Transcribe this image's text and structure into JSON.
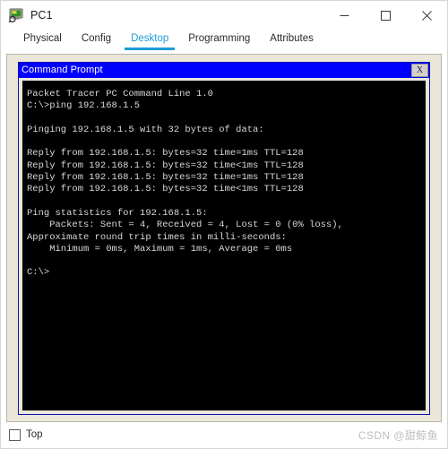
{
  "window": {
    "title": "PC1",
    "icon": "pc-device-icon",
    "controls": [
      {
        "name": "minimize-button",
        "glyph": "minimize-icon"
      },
      {
        "name": "maximize-button",
        "glyph": "maximize-icon"
      },
      {
        "name": "close-button",
        "glyph": "close-icon"
      }
    ]
  },
  "tabs": [
    {
      "label": "Physical",
      "active": false
    },
    {
      "label": "Config",
      "active": false
    },
    {
      "label": "Desktop",
      "active": true
    },
    {
      "label": "Programming",
      "active": false
    },
    {
      "label": "Attributes",
      "active": false
    }
  ],
  "console": {
    "title": "Command Prompt",
    "close_label": "X",
    "lines": [
      "Packet Tracer PC Command Line 1.0",
      "C:\\>ping 192.168.1.5",
      "",
      "Pinging 192.168.1.5 with 32 bytes of data:",
      "",
      "Reply from 192.168.1.5: bytes=32 time=1ms TTL=128",
      "Reply from 192.168.1.5: bytes=32 time<1ms TTL=128",
      "Reply from 192.168.1.5: bytes=32 time=1ms TTL=128",
      "Reply from 192.168.1.5: bytes=32 time<1ms TTL=128",
      "",
      "Ping statistics for 192.168.1.5:",
      "    Packets: Sent = 4, Received = 4, Lost = 0 (0% loss),",
      "Approximate round trip times in milli-seconds:",
      "    Minimum = 0ms, Maximum = 1ms, Average = 0ms",
      "",
      "C:\\>"
    ]
  },
  "footer": {
    "top_checkbox_label": "Top",
    "top_checkbox_checked": false,
    "watermark": "CSDN @甜鲸鱼"
  },
  "colors": {
    "tab_active": "#1c9cd8",
    "console_title_bg": "#0000ff",
    "panel_bg": "#eae6d9",
    "console_bg": "#000000",
    "console_text": "#d8d8d8"
  }
}
